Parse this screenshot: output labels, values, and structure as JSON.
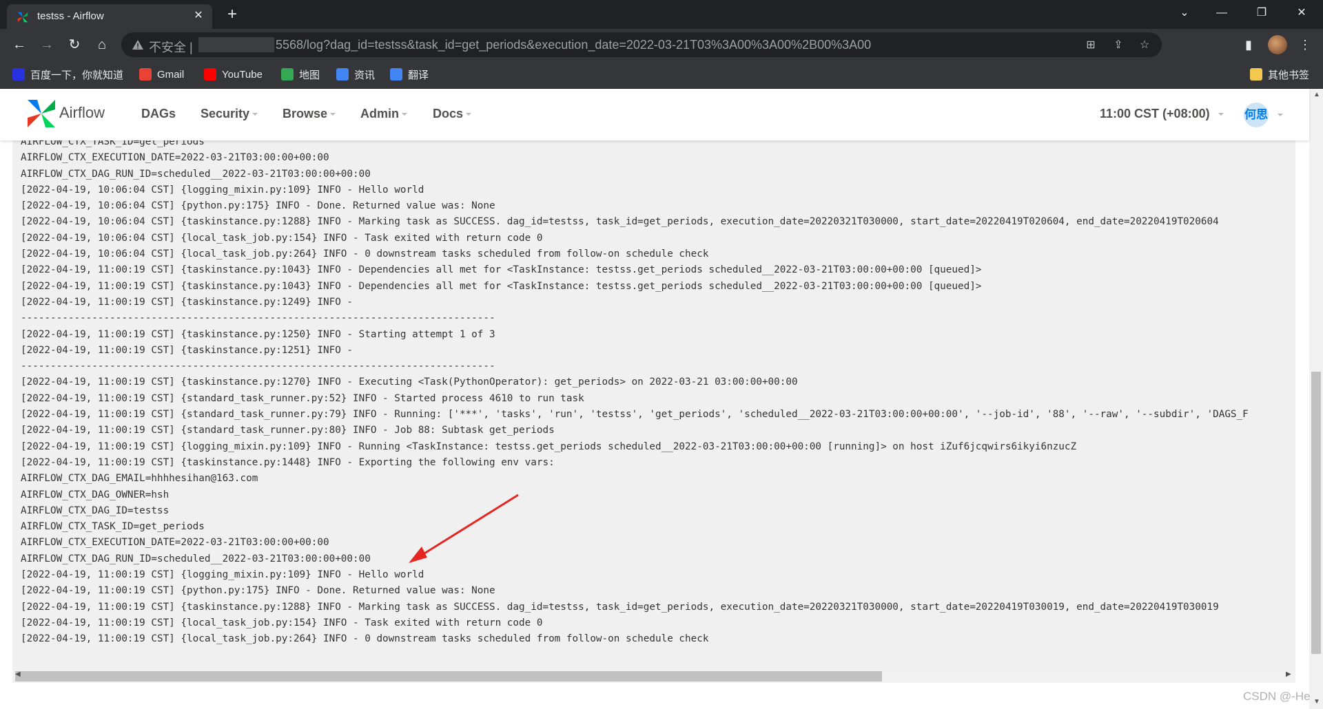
{
  "browser": {
    "tab_title": "testss - Airflow",
    "tab_close": "✕",
    "new_tab": "+",
    "window_controls": [
      "⌄",
      "—",
      "❐",
      "✕"
    ],
    "not_secure": "不安全 |",
    "url_suffix": "5568/log?dag_id=testss&task_id=get_periods&execution_date=2022-03-21T03%3A00%3A00%2B00%3A00",
    "bookmarks": [
      {
        "label": "百度一下，你就知道",
        "icon": "baidu-icon",
        "color": "#2932e1"
      },
      {
        "label": "Gmail",
        "icon": "gmail-icon",
        "color": "#ea4335"
      },
      {
        "label": "YouTube",
        "icon": "youtube-icon",
        "color": "#ff0000"
      },
      {
        "label": "地图",
        "icon": "maps-icon",
        "color": "#34a853"
      },
      {
        "label": "资讯",
        "icon": "news-icon",
        "color": "#4285f4"
      },
      {
        "label": "翻译",
        "icon": "translate-icon",
        "color": "#4285f4"
      }
    ],
    "other_bookmarks": "其他书签"
  },
  "airflow": {
    "brand": "Airflow",
    "menu": [
      "DAGs",
      "Security",
      "Browse",
      "Admin",
      "Docs"
    ],
    "time": "11:00 CST (+08:00)",
    "user_initials": "何思"
  },
  "log_lines": [
    "AIRFLOW_CTX_TASK_ID=get_periods",
    "AIRFLOW_CTX_EXECUTION_DATE=2022-03-21T03:00:00+00:00",
    "AIRFLOW_CTX_DAG_RUN_ID=scheduled__2022-03-21T03:00:00+00:00",
    "[2022-04-19, 10:06:04 CST] {logging_mixin.py:109} INFO - Hello world",
    "[2022-04-19, 10:06:04 CST] {python.py:175} INFO - Done. Returned value was: None",
    "[2022-04-19, 10:06:04 CST] {taskinstance.py:1288} INFO - Marking task as SUCCESS. dag_id=testss, task_id=get_periods, execution_date=20220321T030000, start_date=20220419T020604, end_date=20220419T020604",
    "[2022-04-19, 10:06:04 CST] {local_task_job.py:154} INFO - Task exited with return code 0",
    "[2022-04-19, 10:06:04 CST] {local_task_job.py:264} INFO - 0 downstream tasks scheduled from follow-on schedule check",
    "[2022-04-19, 11:00:19 CST] {taskinstance.py:1043} INFO - Dependencies all met for <TaskInstance: testss.get_periods scheduled__2022-03-21T03:00:00+00:00 [queued]>",
    "[2022-04-19, 11:00:19 CST] {taskinstance.py:1043} INFO - Dependencies all met for <TaskInstance: testss.get_periods scheduled__2022-03-21T03:00:00+00:00 [queued]>",
    "[2022-04-19, 11:00:19 CST] {taskinstance.py:1249} INFO -",
    "--------------------------------------------------------------------------------",
    "[2022-04-19, 11:00:19 CST] {taskinstance.py:1250} INFO - Starting attempt 1 of 3",
    "[2022-04-19, 11:00:19 CST] {taskinstance.py:1251} INFO -",
    "--------------------------------------------------------------------------------",
    "[2022-04-19, 11:00:19 CST] {taskinstance.py:1270} INFO - Executing <Task(PythonOperator): get_periods> on 2022-03-21 03:00:00+00:00",
    "[2022-04-19, 11:00:19 CST] {standard_task_runner.py:52} INFO - Started process 4610 to run task",
    "[2022-04-19, 11:00:19 CST] {standard_task_runner.py:79} INFO - Running: ['***', 'tasks', 'run', 'testss', 'get_periods', 'scheduled__2022-03-21T03:00:00+00:00', '--job-id', '88', '--raw', '--subdir', 'DAGS_F",
    "[2022-04-19, 11:00:19 CST] {standard_task_runner.py:80} INFO - Job 88: Subtask get_periods",
    "[2022-04-19, 11:00:19 CST] {logging_mixin.py:109} INFO - Running <TaskInstance: testss.get_periods scheduled__2022-03-21T03:00:00+00:00 [running]> on host iZuf6jcqwirs6ikyi6nzucZ",
    "[2022-04-19, 11:00:19 CST] {taskinstance.py:1448} INFO - Exporting the following env vars:",
    "AIRFLOW_CTX_DAG_EMAIL=hhhhesihan@163.com",
    "AIRFLOW_CTX_DAG_OWNER=hsh",
    "AIRFLOW_CTX_DAG_ID=testss",
    "AIRFLOW_CTX_TASK_ID=get_periods",
    "AIRFLOW_CTX_EXECUTION_DATE=2022-03-21T03:00:00+00:00",
    "AIRFLOW_CTX_DAG_RUN_ID=scheduled__2022-03-21T03:00:00+00:00",
    "[2022-04-19, 11:00:19 CST] {logging_mixin.py:109} INFO - Hello world",
    "[2022-04-19, 11:00:19 CST] {python.py:175} INFO - Done. Returned value was: None",
    "[2022-04-19, 11:00:19 CST] {taskinstance.py:1288} INFO - Marking task as SUCCESS. dag_id=testss, task_id=get_periods, execution_date=20220321T030000, start_date=20220419T030019, end_date=20220419T030019",
    "[2022-04-19, 11:00:19 CST] {local_task_job.py:154} INFO - Task exited with return code 0",
    "[2022-04-19, 11:00:19 CST] {local_task_job.py:264} INFO - 0 downstream tasks scheduled from follow-on schedule check"
  ],
  "watermark": "CSDN @-He",
  "annotation": {
    "arrow_color": "#e5251f"
  }
}
